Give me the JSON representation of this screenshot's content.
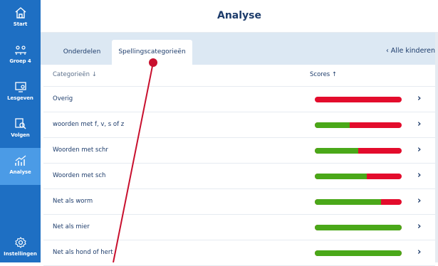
{
  "sidebar": {
    "items": [
      {
        "label": "Start",
        "icon": "home-icon"
      },
      {
        "label": "Groep 4",
        "icon": "group-icon"
      },
      {
        "label": "Lesgeven",
        "icon": "teach-icon"
      },
      {
        "label": "Volgen",
        "icon": "follow-icon"
      },
      {
        "label": "Analyse",
        "icon": "chart-icon",
        "active": true
      }
    ],
    "settings_label": "Instellingen"
  },
  "header": {
    "title": "Analyse"
  },
  "tabs": [
    {
      "label": "Onderdelen"
    },
    {
      "label": "Spellingscategorieën",
      "active": true
    }
  ],
  "back_link": "‹  Alle kinderen",
  "table": {
    "columns": {
      "category": "Categorieën ↓",
      "scores": "Scores ↑"
    },
    "rows": [
      {
        "label": "Overig",
        "score_green_fraction": 0.0
      },
      {
        "label": "woorden met f, v, s of z",
        "score_green_fraction": 0.4
      },
      {
        "label": "Woorden met schr",
        "score_green_fraction": 0.5
      },
      {
        "label": "Woorden met sch",
        "score_green_fraction": 0.6
      },
      {
        "label": "Net als worm",
        "score_green_fraction": 0.76
      },
      {
        "label": "Net als mier",
        "score_green_fraction": 1.0
      },
      {
        "label": "Net als hond of hert",
        "score_green_fraction": 1.0
      }
    ],
    "row_chevron": "›"
  },
  "colors": {
    "sidebar": "#1e6fc3",
    "active_nav": "#4b9be6",
    "bar_green": "#4aa819",
    "bar_red": "#e30c2c",
    "annotation": "#c8102e"
  }
}
